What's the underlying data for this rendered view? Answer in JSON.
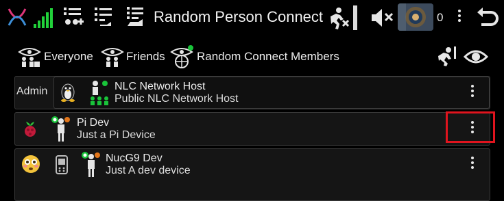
{
  "header": {
    "title": "Random Person Connect",
    "notification_count": "0",
    "icons": [
      "app-logo-icon",
      "signal-strength-icon",
      "network-add-icon",
      "list-icon",
      "hand-list-icon",
      "no-run-icon",
      "mute-icon",
      "avatar",
      "overflow-menu-icon",
      "back-icon"
    ]
  },
  "filters": {
    "everyone": "Everyone",
    "friends": "Friends",
    "random_connect_members": "Random Connect Members"
  },
  "rows": [
    {
      "prefix": "Admin",
      "name": "NLC Network Host",
      "subtitle": "Public NLC Network Host"
    },
    {
      "name": "Pi Dev",
      "subtitle": "Just a Pi Device"
    },
    {
      "name": "NucG9 Dev",
      "subtitle": "Just A dev device"
    }
  ],
  "colors": {
    "background": "#000000",
    "online_green": "#19c43a",
    "away_orange": "#e2761b",
    "highlight_red": "#e0141e",
    "logo_pink": "#e0357a",
    "logo_blue": "#3d8fd8"
  }
}
